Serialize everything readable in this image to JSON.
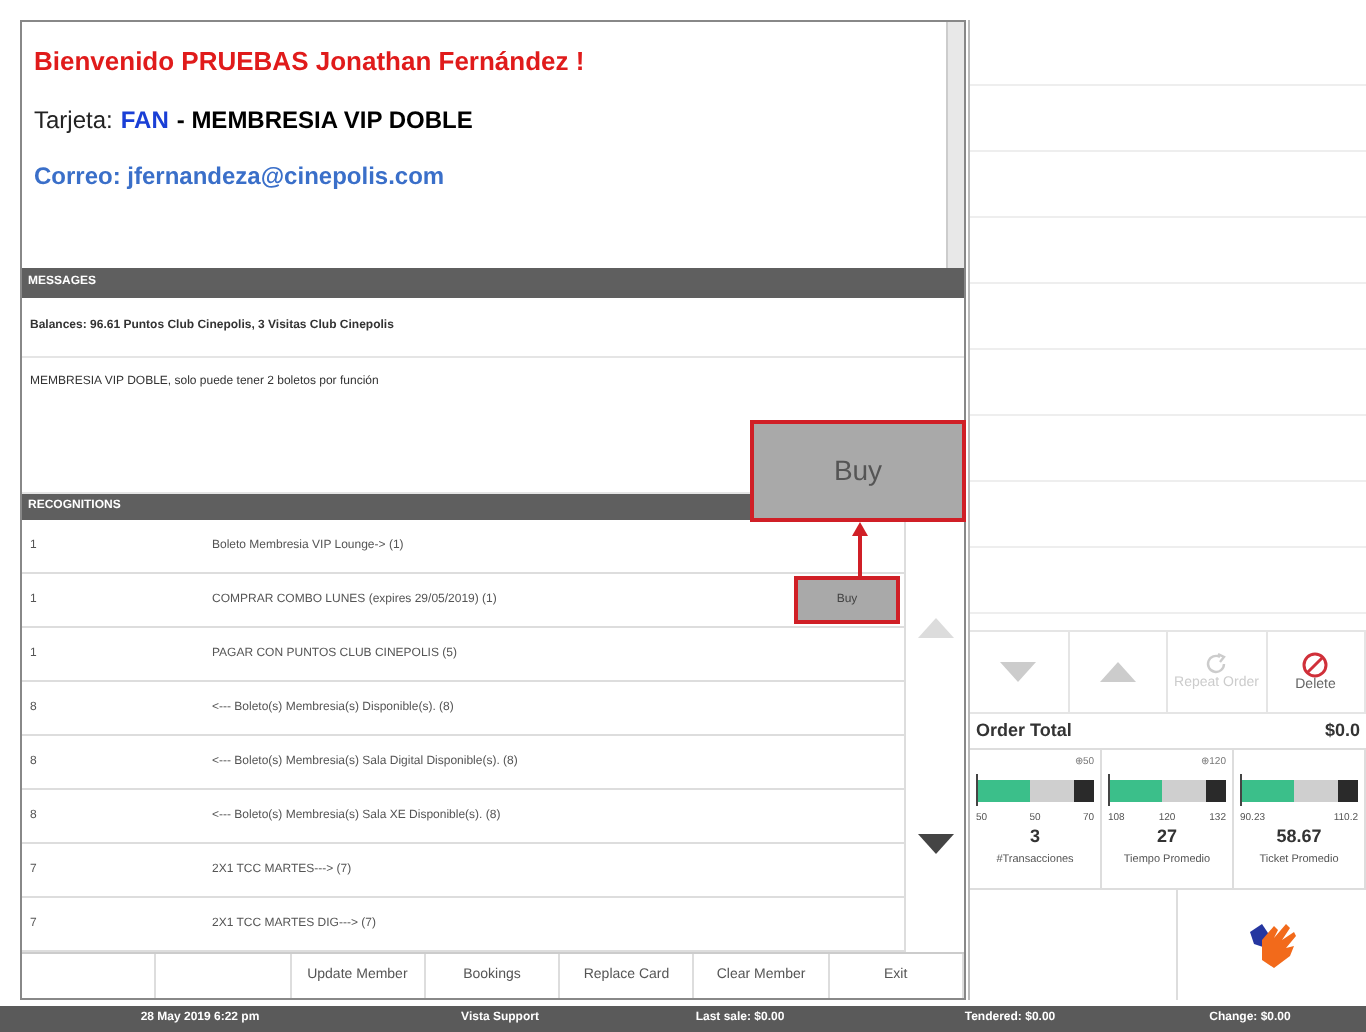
{
  "member": {
    "welcome": "Bienvenido PRUEBAS Jonathan Fernández !",
    "card_label": "Tarjeta:",
    "card_type": "FAN",
    "card_name": "- MEMBRESIA VIP DOBLE",
    "email": "Correo: jfernandeza@cinepolis.com"
  },
  "messages": {
    "title": "MESSAGES",
    "items": [
      "Balances: 96.61 Puntos Club Cinepolis, 3 Visitas Club Cinepolis",
      "MEMBRESIA VIP DOBLE, solo puede tener 2 boletos por función"
    ]
  },
  "callout": {
    "label": "Buy"
  },
  "recognitions": {
    "title": "RECOGNITIONS",
    "rows": [
      {
        "qty": "1",
        "name": "Boleto Membresia VIP Lounge-> (1)"
      },
      {
        "qty": "1",
        "name": "COMPRAR COMBO LUNES (expires 29/05/2019) (1)",
        "action": "Buy"
      },
      {
        "qty": "1",
        "name": "PAGAR CON PUNTOS CLUB CINEPOLIS (5)"
      },
      {
        "qty": "8",
        "name": "<--- Boleto(s) Membresia(s) Disponible(s). (8)"
      },
      {
        "qty": "8",
        "name": "<--- Boleto(s)  Membresia(s) Sala Digital Disponible(s). (8)"
      },
      {
        "qty": "8",
        "name": "<--- Boleto(s)  Membresia(s) Sala XE Disponible(s). (8)"
      },
      {
        "qty": "7",
        "name": "2X1 TCC MARTES---> (7)"
      },
      {
        "qty": "7",
        "name": "2X1 TCC MARTES DIG---> (7)"
      }
    ]
  },
  "member_buttons": [
    {
      "kind": "blank"
    },
    {
      "kind": "blank"
    },
    {
      "kind": "action",
      "label": "Update Member"
    },
    {
      "kind": "action",
      "label": "Bookings"
    },
    {
      "kind": "action",
      "label": "Replace Card"
    },
    {
      "kind": "action",
      "label": "Clear Member"
    },
    {
      "kind": "action",
      "label": "Exit"
    }
  ],
  "order_toolbar": [
    {
      "kind": "down"
    },
    {
      "kind": "up"
    },
    {
      "kind": "repeat",
      "label": "Repeat Order",
      "disabled": true
    },
    {
      "kind": "delete",
      "label": "Delete",
      "disabled": false
    }
  ],
  "order_total": {
    "label": "Order Total",
    "value": "$0.0"
  },
  "gauges": [
    {
      "target": "⊕50",
      "ticks": [
        "50",
        "50",
        "70"
      ],
      "value": "3",
      "label": "#Transacciones",
      "level": 0.55
    },
    {
      "target": "⊕120",
      "ticks": [
        "108",
        "120",
        "132"
      ],
      "value": "27",
      "label": "Tiempo Promedio",
      "level": 0.55
    },
    {
      "ticks": [
        "90.23",
        "110.2"
      ],
      "value": "58.67",
      "label": "Ticket Promedio",
      "level": 0.55
    }
  ],
  "status_bar": [
    "28 May 2019 6:22 pm",
    "Vista Support",
    "Last sale: $0.00",
    "Tendered: $0.00",
    "Change: $0.00"
  ]
}
